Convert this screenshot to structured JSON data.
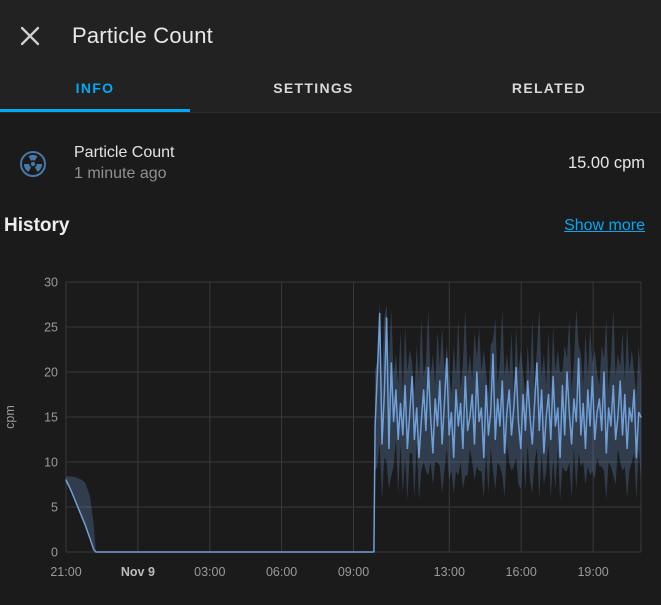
{
  "header": {
    "title": "Particle Count"
  },
  "tabs": [
    {
      "label": "INFO",
      "active": true
    },
    {
      "label": "SETTINGS",
      "active": false
    },
    {
      "label": "RELATED",
      "active": false
    }
  ],
  "sensor": {
    "icon": "radioactive-icon",
    "name": "Particle Count",
    "last_changed": "1 minute ago",
    "value": "15.00 cpm"
  },
  "history": {
    "heading": "History",
    "show_more_label": "Show more"
  },
  "colors": {
    "accent": "#03a9f4",
    "line": "#6f9fd8",
    "band": "rgba(111,159,216,0.26)",
    "grid": "#3a3a3a",
    "axis_text": "#9a9a9a",
    "icon": "#4779a8"
  },
  "chart_data": {
    "type": "line",
    "title": "History",
    "ylabel": "cpm",
    "unit": "cpm",
    "ylim": [
      0,
      30
    ],
    "yticks": [
      0,
      5,
      10,
      15,
      20,
      25,
      30
    ],
    "x_span_hours": 24,
    "xticks": [
      {
        "h": 0,
        "label": "21:00",
        "bold": false
      },
      {
        "h": 3,
        "label": "Nov 9",
        "bold": true
      },
      {
        "h": 6,
        "label": "03:00",
        "bold": false
      },
      {
        "h": 9,
        "label": "06:00",
        "bold": false
      },
      {
        "h": 12,
        "label": "09:00",
        "bold": false
      },
      {
        "h": 16,
        "label": "13:00",
        "bold": false
      },
      {
        "h": 19,
        "label": "16:00",
        "bold": false
      },
      {
        "h": 22,
        "label": "19:00",
        "bold": false
      }
    ],
    "grid": true,
    "legend": false,
    "series": [
      {
        "name": "Particle Count",
        "pre_points": [
          [
            0,
            8
          ],
          [
            0.2,
            6.9
          ],
          [
            0.4,
            5.6
          ],
          [
            0.6,
            4.3
          ],
          [
            0.8,
            3.0
          ],
          [
            1.0,
            1.5
          ],
          [
            1.15,
            0.3
          ],
          [
            1.25,
            0
          ]
        ],
        "zero_until": 12.85,
        "noisy": {
          "t_start": 12.9,
          "t_end": 24.0,
          "values": [
            14,
            20,
            26.5,
            12,
            17.5,
            26,
            11.5,
            21,
            14.5,
            18,
            12.5,
            16.5,
            13,
            18.5,
            11.5,
            15.5,
            19.5,
            12.5,
            16,
            10.5,
            14.5,
            18,
            13.5,
            20.5,
            15,
            11,
            17,
            14,
            19,
            12,
            16.5,
            21.5,
            13,
            15.5,
            10.5,
            18,
            14,
            16.5,
            11.5,
            19.5,
            13.5,
            15,
            17.5,
            12,
            20,
            14.5,
            16,
            10.5,
            18.5,
            13,
            15.5,
            22,
            12.5,
            17,
            14,
            19,
            11,
            15.5,
            18,
            13,
            16,
            20.5,
            14.5,
            11.5,
            17.5,
            13.5,
            19,
            15,
            12,
            16.5,
            21,
            13.5,
            18,
            11,
            15,
            17.5,
            12.5,
            19.5,
            14,
            16,
            10.5,
            18.5,
            13,
            20,
            15.5,
            12,
            17,
            14.5,
            21.5,
            13,
            16.5,
            11.5,
            18,
            14,
            19.5,
            12.5,
            15.5,
            17,
            13.5,
            20,
            11,
            16,
            14,
            18.5,
            12.5,
            15,
            19,
            13,
            17.5,
            11.5,
            16,
            14.5,
            18,
            10.5,
            15.5,
            15
          ]
        },
        "band": {
          "pre_points": [
            [
              0,
              7.6,
              8.4
            ],
            [
              0.2,
              6.9,
              8.4
            ],
            [
              0.4,
              5.6,
              8.3
            ],
            [
              0.6,
              4.3,
              8.1
            ],
            [
              0.8,
              3.0,
              7.7
            ],
            [
              1.0,
              1.5,
              6.2
            ],
            [
              1.15,
              0.3,
              3.2
            ],
            [
              1.25,
              0,
              0
            ]
          ],
          "max_offsets": [
            6,
            3.5,
            9,
            5,
            12,
            4,
            7,
            13,
            5.5,
            8,
            4.5,
            10.5,
            3.5,
            11,
            6,
            8.5
          ],
          "min_offsets": [
            5,
            6.5,
            4,
            7,
            5.5,
            6,
            4.5,
            7.5,
            5,
            3.5,
            6,
            4,
            6.5,
            5.5,
            7,
            4.5
          ],
          "max_cap": 27.8,
          "min_floor": 5.8
        }
      }
    ]
  }
}
